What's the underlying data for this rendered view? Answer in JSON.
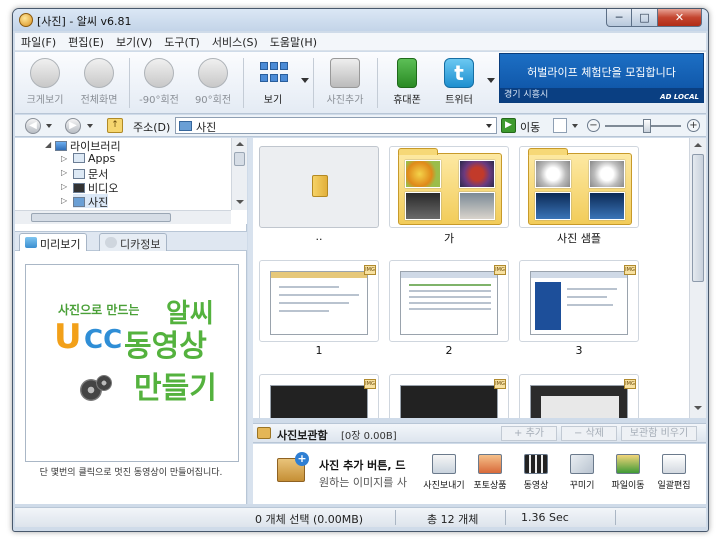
{
  "window": {
    "title": "[사진] - 알씨 v6.81",
    "caption": {
      "minimize": "─",
      "maximize": "□",
      "close": "✕"
    }
  },
  "menu": [
    "파일(F)",
    "편집(E)",
    "보기(V)",
    "도구(T)",
    "서비스(S)",
    "도움말(H)"
  ],
  "toolbar": {
    "zoom_view": "크게보기",
    "fullscreen": "전체화면",
    "rotate_left": "-90°회전",
    "rotate_right": "90°회전",
    "view": "보기",
    "add_photo": "사진추가",
    "mobile": "휴대폰",
    "twitter": "트위터",
    "twitter_glyph": "t"
  },
  "ad": {
    "main": "허벌라이프 체험단을 모집합니다",
    "sub": "경기 시흥시",
    "logo": "AD LOCAL"
  },
  "address": {
    "label": "주소(D)",
    "value": "사진",
    "go": "이동",
    "up_glyph": "↑",
    "zoom_minus": "−",
    "zoom_plus": "+",
    "back_glyph": "◀",
    "forward_glyph": "▶"
  },
  "tree": {
    "root": "라이브러리",
    "items": [
      "Apps",
      "문서",
      "비디오",
      "사진"
    ]
  },
  "tabs": {
    "preview": "미리보기",
    "info": "디카정보"
  },
  "preview": {
    "line1": "사진으로 만드는",
    "brand": "알씨",
    "u": "U",
    "cc": "CC",
    "movie": "동영상",
    "make": "만들기",
    "caption": "단 몇번의 클릭으로 멋진 동영상이 만들어집니다."
  },
  "thumbnails": [
    "..",
    "가",
    "사진 샘플",
    "1",
    "2",
    "3"
  ],
  "badge": "IMG",
  "photobox": {
    "title": "사진보관함",
    "count": "[0장 0.00B]",
    "add_btn": "+ 추가",
    "delete_btn": "− 삭제",
    "empty_btn": "보관함 비우기",
    "message_line1": "사진 추가 버튼, 드",
    "message_line2": "원하는 이미지를 사",
    "plus": "+",
    "actions": [
      "사진보내기",
      "포토상품",
      "동영상",
      "꾸미기",
      "파일이동",
      "일괄편집"
    ]
  },
  "status": {
    "selection": "0 개체 선택 (0.00MB)",
    "total": "총 12 개체",
    "time": "1.36 Sec"
  },
  "colors": {
    "ad_blue": "#0b4fa0",
    "folder_yellow": "#f2cc5a",
    "brand_green": "#54b23e"
  }
}
